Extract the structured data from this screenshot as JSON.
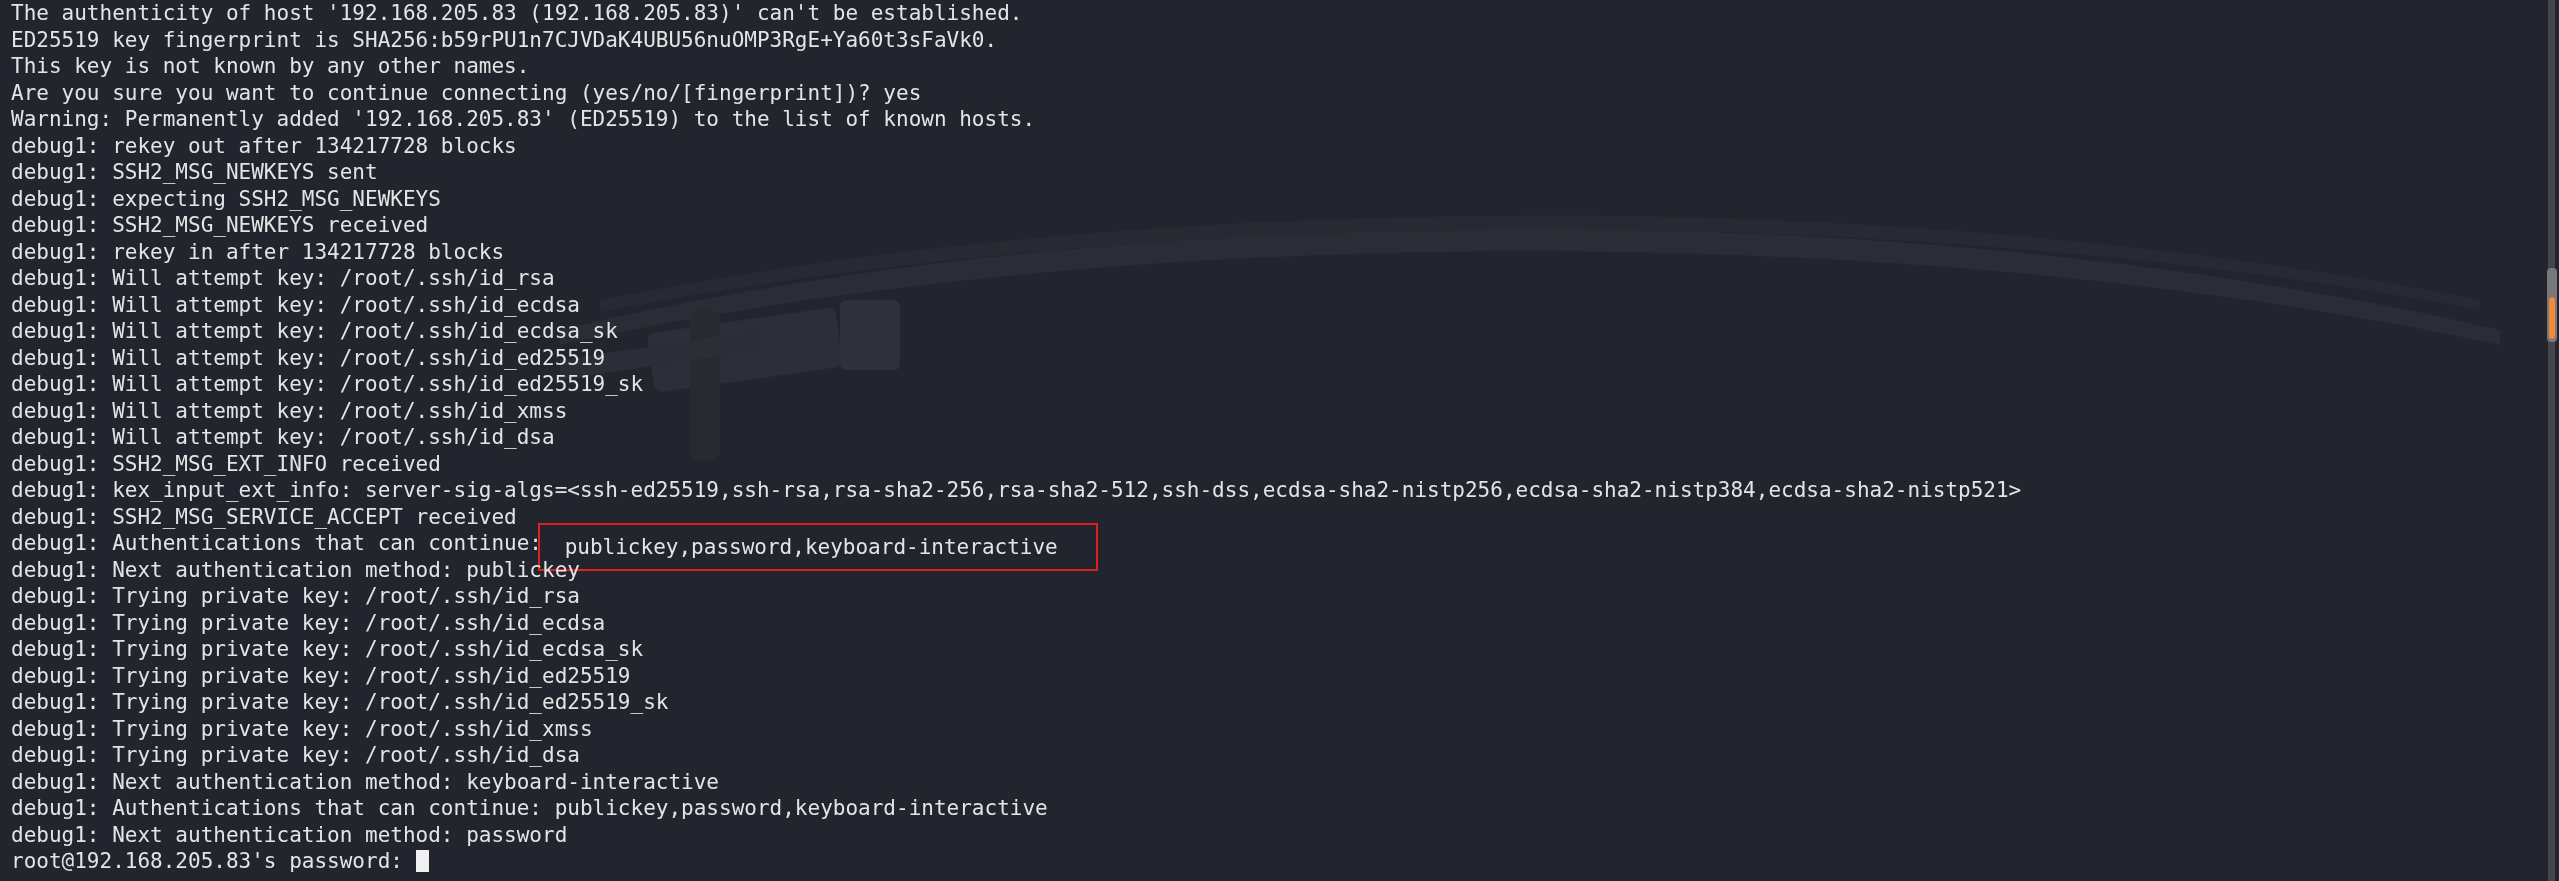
{
  "terminal": {
    "lines": [
      {
        "kind": "plain",
        "text": "The authenticity of host '192.168.205.83 (192.168.205.83)' can't be established."
      },
      {
        "kind": "plain",
        "text": "ED25519 key fingerprint is SHA256:b59rPU1n7CJVDaK4UBU56nuOMP3RgE+Ya60t3sFaVk0."
      },
      {
        "kind": "plain",
        "text": "This key is not known by any other names."
      },
      {
        "kind": "plain",
        "text": "Are you sure you want to continue connecting (yes/no/[fingerprint])? yes"
      },
      {
        "kind": "plain",
        "text": "Warning: Permanently added '192.168.205.83' (ED25519) to the list of known hosts."
      },
      {
        "kind": "plain",
        "text": "debug1: rekey out after 134217728 blocks"
      },
      {
        "kind": "plain",
        "text": "debug1: SSH2_MSG_NEWKEYS sent"
      },
      {
        "kind": "plain",
        "text": "debug1: expecting SSH2_MSG_NEWKEYS"
      },
      {
        "kind": "plain",
        "text": "debug1: SSH2_MSG_NEWKEYS received"
      },
      {
        "kind": "plain",
        "text": "debug1: rekey in after 134217728 blocks"
      },
      {
        "kind": "plain",
        "text": "debug1: Will attempt key: /root/.ssh/id_rsa"
      },
      {
        "kind": "plain",
        "text": "debug1: Will attempt key: /root/.ssh/id_ecdsa"
      },
      {
        "kind": "plain",
        "text": "debug1: Will attempt key: /root/.ssh/id_ecdsa_sk"
      },
      {
        "kind": "plain",
        "text": "debug1: Will attempt key: /root/.ssh/id_ed25519"
      },
      {
        "kind": "plain",
        "text": "debug1: Will attempt key: /root/.ssh/id_ed25519_sk"
      },
      {
        "kind": "plain",
        "text": "debug1: Will attempt key: /root/.ssh/id_xmss"
      },
      {
        "kind": "plain",
        "text": "debug1: Will attempt key: /root/.ssh/id_dsa"
      },
      {
        "kind": "plain",
        "text": "debug1: SSH2_MSG_EXT_INFO received"
      },
      {
        "kind": "plain",
        "text": "debug1: kex_input_ext_info: server-sig-algs=<ssh-ed25519,ssh-rsa,rsa-sha2-256,rsa-sha2-512,ssh-dss,ecdsa-sha2-nistp256,ecdsa-sha2-nistp384,ecdsa-sha2-nistp521>"
      },
      {
        "kind": "plain",
        "text": "debug1: SSH2_MSG_SERVICE_ACCEPT received"
      },
      {
        "kind": "marked",
        "text": "debug1: Authentications that can continue:",
        "marked": "publickey,password,keyboard-interactive"
      },
      {
        "kind": "plain",
        "text": "debug1: Next authentication method: publickey"
      },
      {
        "kind": "plain",
        "text": "debug1: Trying private key: /root/.ssh/id_rsa"
      },
      {
        "kind": "plain",
        "text": "debug1: Trying private key: /root/.ssh/id_ecdsa"
      },
      {
        "kind": "plain",
        "text": "debug1: Trying private key: /root/.ssh/id_ecdsa_sk"
      },
      {
        "kind": "plain",
        "text": "debug1: Trying private key: /root/.ssh/id_ed25519"
      },
      {
        "kind": "plain",
        "text": "debug1: Trying private key: /root/.ssh/id_ed25519_sk"
      },
      {
        "kind": "plain",
        "text": "debug1: Trying private key: /root/.ssh/id_xmss"
      },
      {
        "kind": "plain",
        "text": "debug1: Trying private key: /root/.ssh/id_dsa"
      },
      {
        "kind": "plain",
        "text": "debug1: Next authentication method: keyboard-interactive"
      },
      {
        "kind": "plain",
        "text": "debug1: Authentications that can continue: publickey,password,keyboard-interactive"
      },
      {
        "kind": "plain",
        "text": "debug1: Next authentication method: password"
      },
      {
        "kind": "prompt",
        "text": "root@192.168.205.83's password:"
      }
    ]
  }
}
